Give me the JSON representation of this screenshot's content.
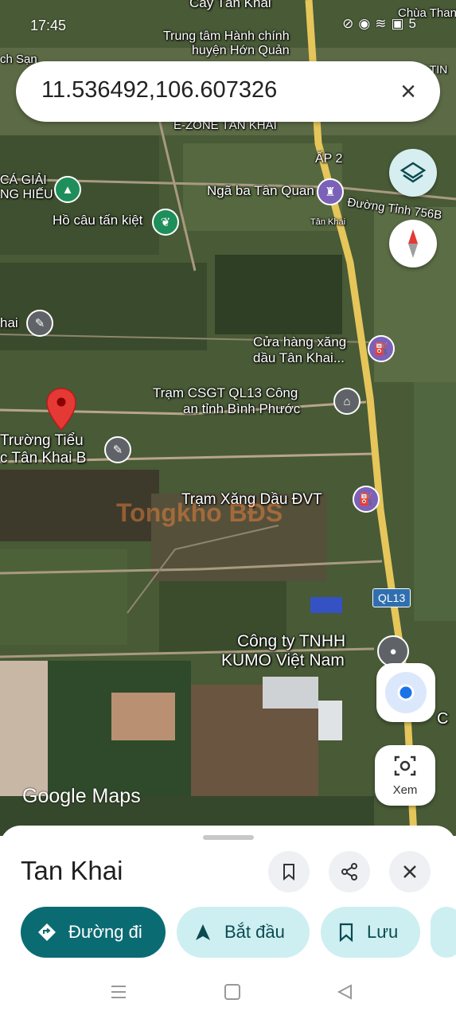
{
  "status_bar": {
    "time": "17:45",
    "battery": "5"
  },
  "search": {
    "value": "11.536492,106.607326"
  },
  "map_labels": {
    "cay_tan_khai": "Cây Tân Khai",
    "chua_thanh": "Chùa Thanh",
    "trung_tam_line1": "Trung tâm Hành chính",
    "trung_tam_line2": "huyện Hớn Quản",
    "ch_san": "ch Sạn",
    "tan_kh": "Tân Kh",
    "y_tin": "Y TIN",
    "ezone": "E-ZONE TÂN KHAI",
    "ap2": "ẤP 2",
    "ca_giai_line1": "CÁ GIẢI",
    "ca_giai_line2": "NG HIẾU",
    "nga_ba": "Ngã ba Tân Quan",
    "duong_tinh": "Đường Tỉnh 756B",
    "tan_khai_small": "Tân Khai",
    "ho_cau": "Hồ câu tấn kiệt",
    "hai": "hai",
    "cua_hang_line1": "Cửa hàng xăng",
    "cua_hang_line2": "dầu Tân Khai...",
    "tram_csgt_line1": "Trạm CSGT QL13 Công",
    "tram_csgt_line2": "an tỉnh Bình Phước",
    "truong_line1": "Trường Tiểu",
    "truong_line2": "c Tân Khai B",
    "tram_xang": "Trạm Xăng Dầu ĐVT",
    "watermark": "Tongkho BĐS",
    "ql13": "QL13",
    "kumo_line1": "Công ty TNHH",
    "kumo_line2": "KUMO Việt Nam",
    "google_maps": "Google Maps",
    "edge_c": "C"
  },
  "controls": {
    "xem_label": "Xem"
  },
  "sheet": {
    "title": "Tan Khai",
    "chips": {
      "directions": "Đường đi",
      "start": "Bắt đầu",
      "save": "Lưu"
    }
  },
  "colors": {
    "directions_chip": "#0b6b73",
    "chip_light": "#cdeff2",
    "chip_text": "#0b4a50",
    "pin_red": "#e53935",
    "poi_gray": "#5f6368",
    "poi_purple": "#7b61b8",
    "poi_green": "#1e8e5a",
    "poi_pink": "#c2185b",
    "road_yellow": "#e6c65a"
  },
  "icons": {
    "search_close": "close-icon",
    "layers": "layers-icon",
    "compass": "compass-icon",
    "my_location": "my-location-icon",
    "xem": "camera-scan-icon",
    "bookmark": "bookmark-icon",
    "share": "share-icon",
    "close": "close-icon",
    "directions": "directions-icon",
    "navigation": "navigation-icon"
  }
}
